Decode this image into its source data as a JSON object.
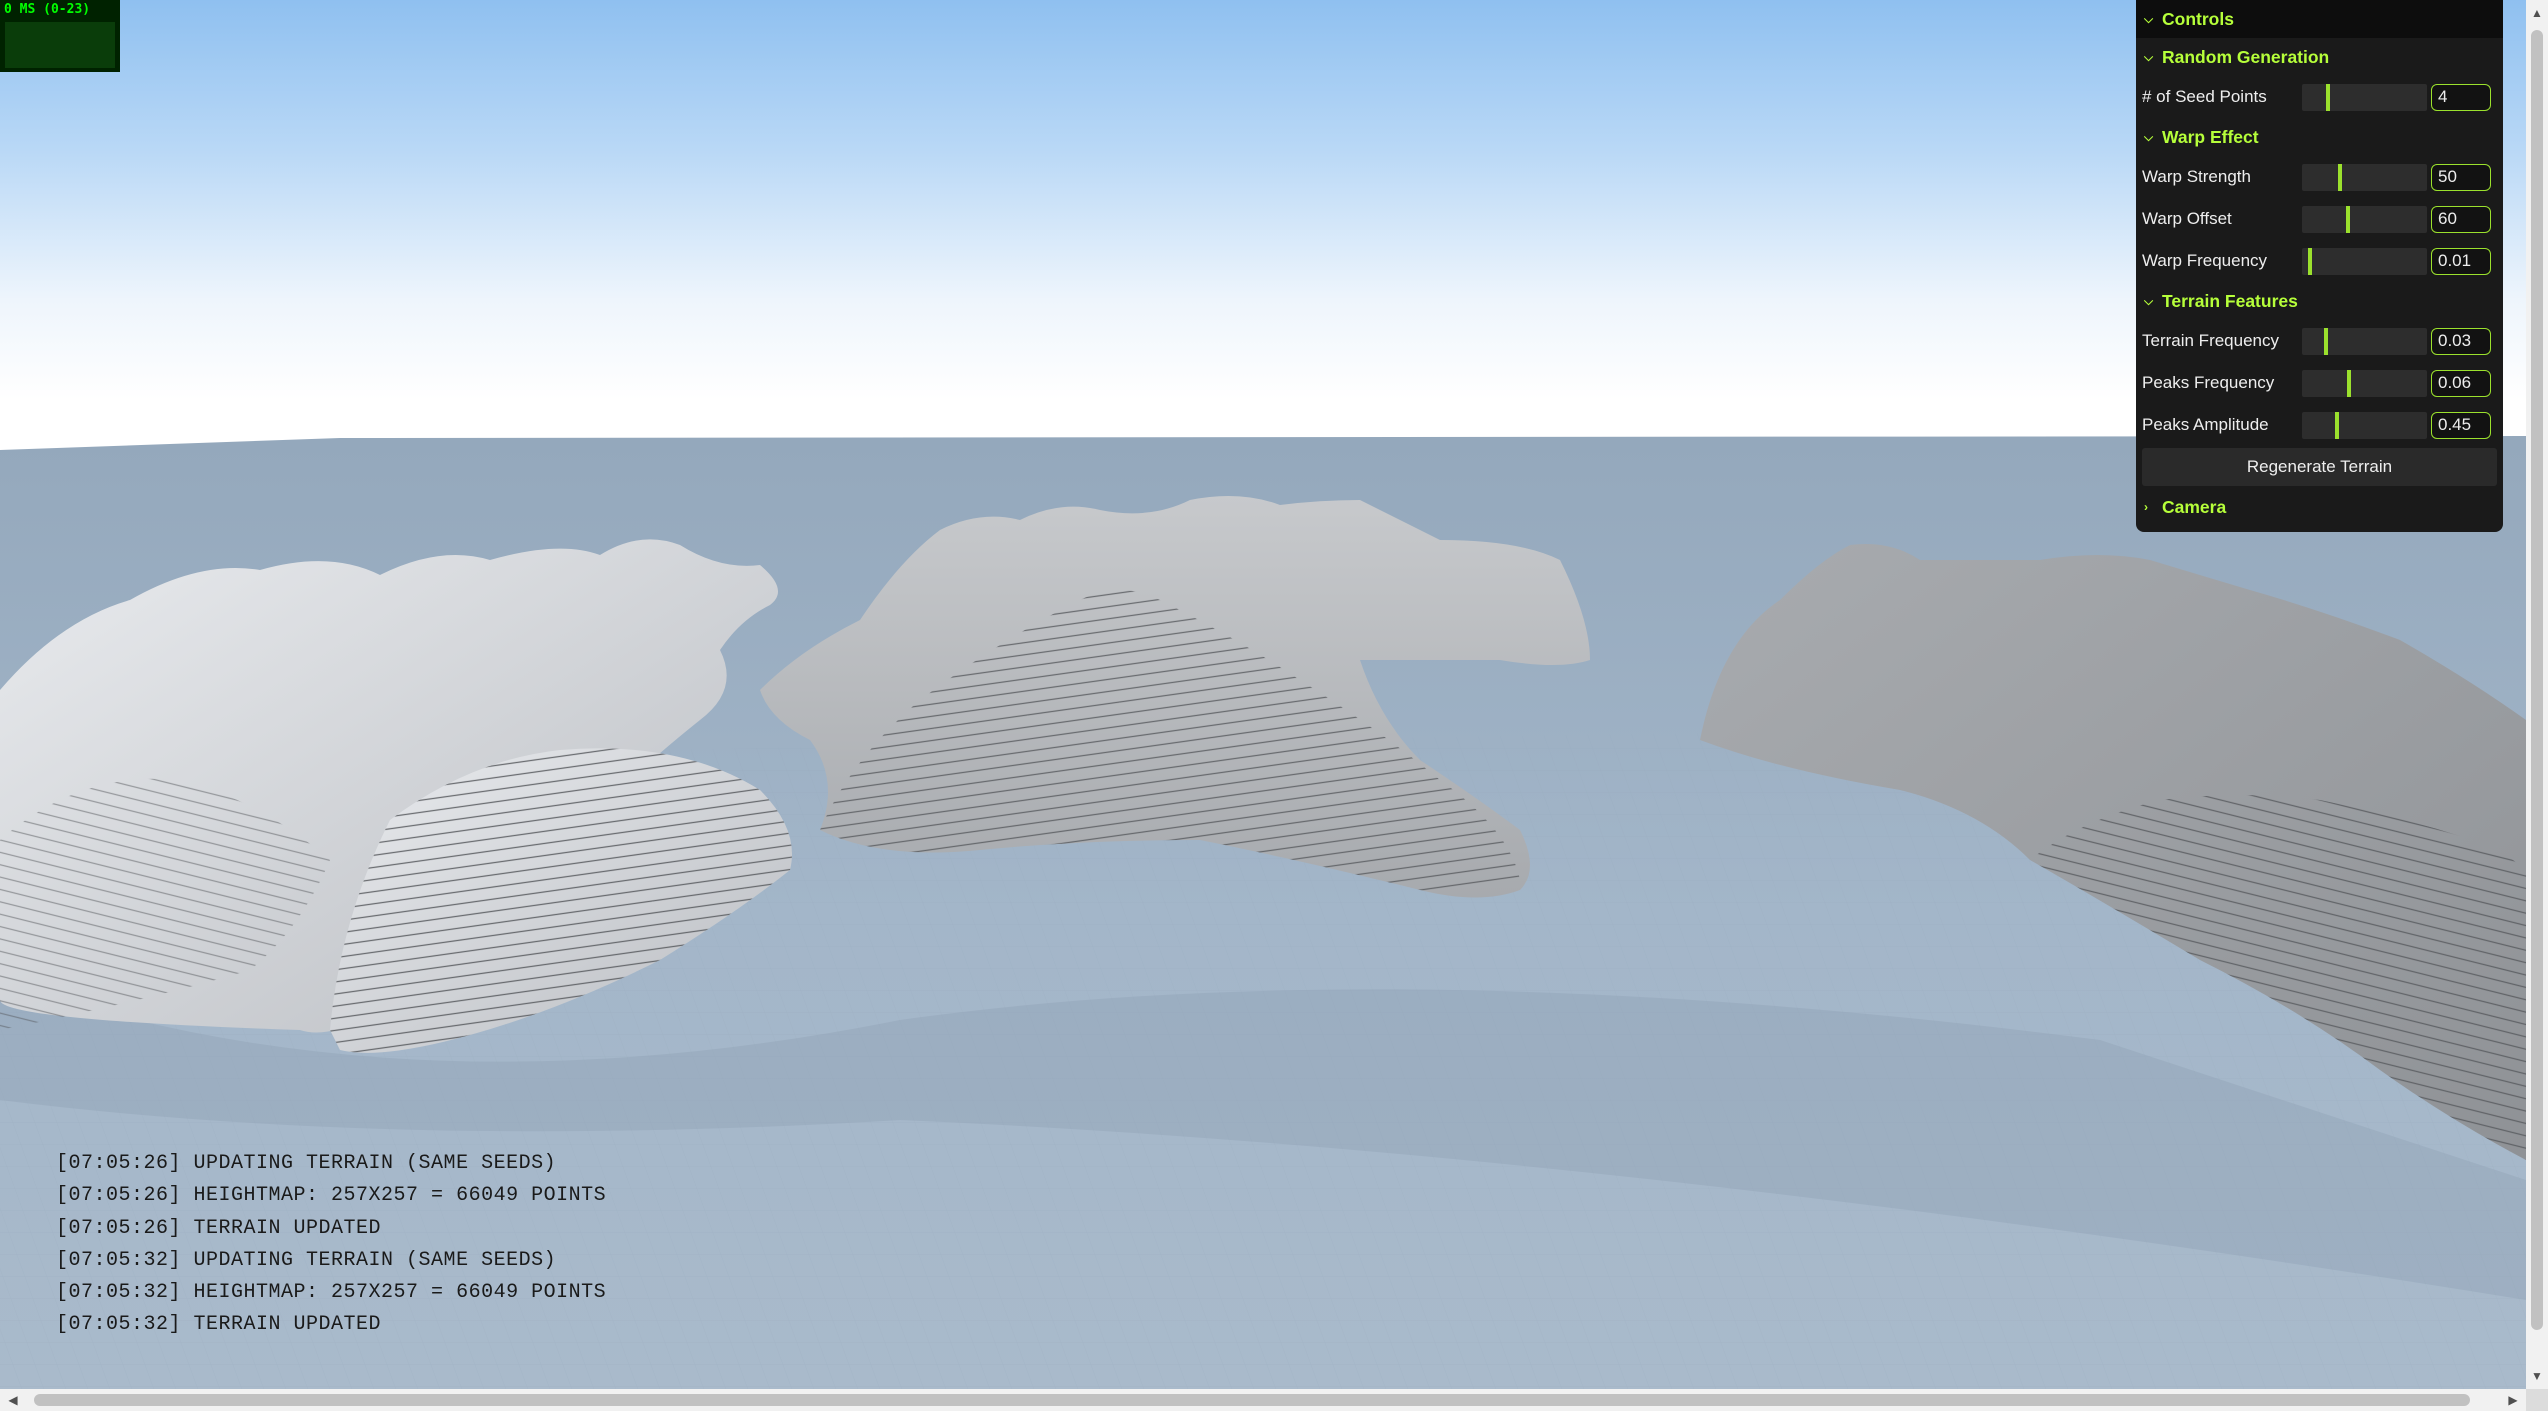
{
  "stats": {
    "label": "0 MS (0-23)"
  },
  "gui": {
    "title": "Controls",
    "folders": {
      "random": {
        "title": "Random Generation"
      },
      "warp": {
        "title": "Warp Effect"
      },
      "terrain": {
        "title": "Terrain Features"
      },
      "camera": {
        "title": "Camera"
      }
    },
    "controls": {
      "seed_points": {
        "label": "# of Seed Points",
        "value": "4",
        "fraction": 0.2
      },
      "warp_strength": {
        "label": "Warp Strength",
        "value": "50",
        "fraction": 0.3
      },
      "warp_offset": {
        "label": "Warp Offset",
        "value": "60",
        "fraction": 0.36
      },
      "warp_frequency": {
        "label": "Warp Frequency",
        "value": "0.01",
        "fraction": 0.05
      },
      "terrain_frequency": {
        "label": "Terrain Frequency",
        "value": "0.03",
        "fraction": 0.18
      },
      "peaks_frequency": {
        "label": "Peaks Frequency",
        "value": "0.06",
        "fraction": 0.37
      },
      "peaks_amplitude": {
        "label": "Peaks Amplitude",
        "value": "0.45",
        "fraction": 0.27
      }
    },
    "regenerate_label": "Regenerate Terrain"
  },
  "log": [
    "[07:05:26] UPDATING TERRAIN (SAME SEEDS)",
    "[07:05:26] HEIGHTMAP: 257x257 = 66049 POINTS",
    "[07:05:26] TERRAIN UPDATED",
    "[07:05:32] UPDATING TERRAIN (SAME SEEDS)",
    "[07:05:32] HEIGHTMAP: 257x257 = 66049 POINTS",
    "[07:05:32] TERRAIN UPDATED"
  ],
  "colors": {
    "accent": "#9be12d",
    "folder_title": "#b6ff3a",
    "panel_bg": "#1a1a1a",
    "ground": "#9cb0c4",
    "terrain": "#c9cbce"
  }
}
